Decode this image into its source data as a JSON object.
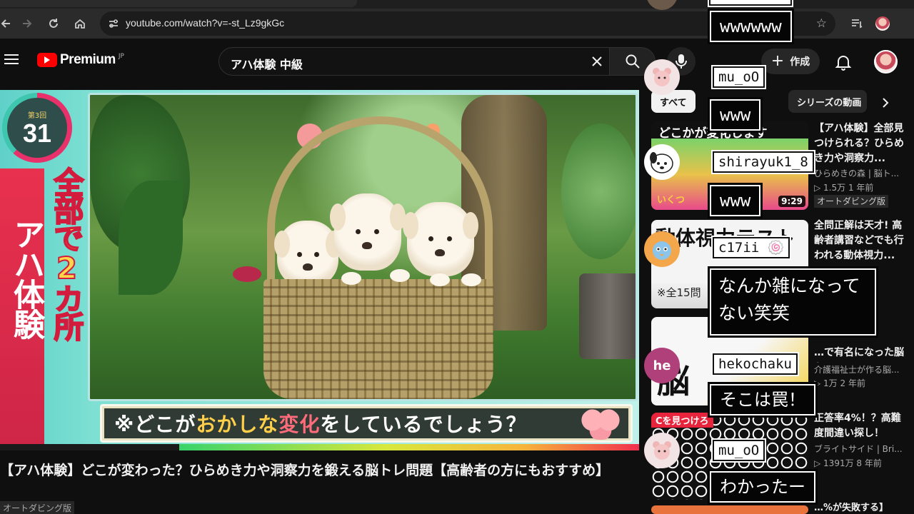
{
  "browser": {
    "url": "youtube.com/watch?v=-st_Lz9gkGc"
  },
  "header": {
    "logo_text": "Premium",
    "region": "JP",
    "search_query": "アハ体験 中級",
    "create_label": "作成"
  },
  "video": {
    "round_label": "第3回",
    "round_number": "31",
    "side_title": "アハ体験",
    "side_subtitle": "全部で2カ所",
    "caption_a": "※どこが",
    "caption_b": "おかしな",
    "caption_c": "変化",
    "caption_d": "をしているでしょう？",
    "progress": 0.28,
    "title": "【アハ体験】どこが変わった？ひらめき力や洞察力を鍛える脳トレ問題【高齢者の方にもおすすめ】",
    "dub_tag": "オートダビング版"
  },
  "sidebar": {
    "chips": [
      "すべて",
      "シリーズの動画"
    ],
    "recommendations": [
      {
        "thumb_text": "どこかが変化します",
        "thumb_sub": "いくつ",
        "duration": "9:29",
        "title": "【アハ体験】全部見つけられる？ひらめき力や洞察力...",
        "channel": "ひらめきの森 | 脳ト...",
        "meta": "▷ 1.5万  1 年前",
        "dub": "オートダビング版"
      },
      {
        "thumb_text": "動体視力テスト",
        "thumb_sub": "※全15問",
        "title": "全問正解は天才! 高齢者講習などでも行われる動体視力...",
        "channel": "",
        "meta": ""
      },
      {
        "thumb_text": "脳",
        "title": "…で有名になった脳ト...",
        "channel": "介護福祉士が作る脳...",
        "meta": "▷ 1万  2 年前"
      },
      {
        "thumb_text": "Cを見つけろ",
        "title": "正答率4%！？高難度間違い探し！",
        "channel": "ブライトサイド | Bri...",
        "meta": "▷ 1391万  8 年前"
      }
    ],
    "last_title_fragment": "…%が失敗する】"
  },
  "chat": [
    {
      "user": "",
      "message": "wwwwww",
      "avatar": ""
    },
    {
      "user": "mu_oO",
      "message": "www",
      "avatar": "bear"
    },
    {
      "user": "shirayuk1_8",
      "message": "www",
      "avatar": "dog"
    },
    {
      "user": "c17ii",
      "message": "なんか雑になって\nない笑笑",
      "avatar": "bird",
      "badge": "🍥"
    },
    {
      "user": "hekochaku",
      "message": "そこは罠！",
      "avatar": "he"
    },
    {
      "user": "mu_oO",
      "message": "わかったー",
      "avatar": "bear"
    }
  ],
  "colors": {
    "youtube_red": "#ff0000",
    "bg": "#0f0f0f",
    "caption_yellow": "#ffcf4a",
    "band_red": "#e8314e"
  }
}
